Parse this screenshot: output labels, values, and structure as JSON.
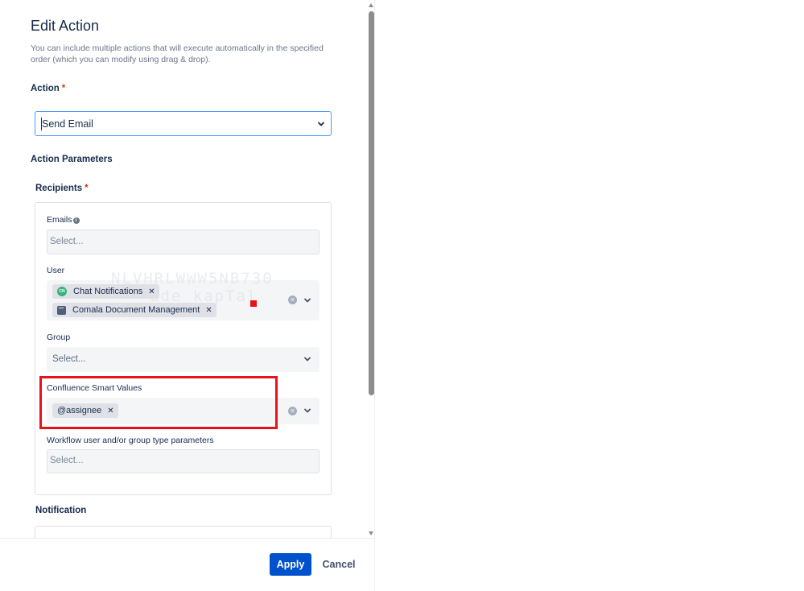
{
  "dialog": {
    "title": "Edit Action",
    "description": "You can include multiple actions that will execute automatically in the specified order (which you can modify using drag & drop)."
  },
  "action": {
    "label": "Action",
    "required_mark": "*",
    "selected_value": "Send Email"
  },
  "action_parameters": {
    "heading": "Action Parameters"
  },
  "recipients": {
    "label": "Recipients",
    "required_mark": "*",
    "emails": {
      "label": "Emails",
      "info_icon": "i",
      "placeholder": "Select..."
    },
    "user": {
      "label": "User",
      "chips": [
        {
          "label": "Chat Notifications",
          "icon": "CN"
        },
        {
          "label": "Comala Document Management",
          "icon": "document-icon"
        }
      ]
    },
    "group": {
      "label": "Group",
      "placeholder": "Select..."
    },
    "smart_values": {
      "label": "Confluence Smart Values",
      "chips": [
        {
          "label": "@assignee"
        }
      ]
    },
    "workflow_params": {
      "label": "Workflow user and/or group type parameters",
      "placeholder": "Select..."
    }
  },
  "notification": {
    "label": "Notification"
  },
  "watermark": {
    "line1": "NLVHRLWWW5NB730",
    "line2": "ude kapTal"
  },
  "footer": {
    "apply_label": "Apply",
    "cancel_label": "Cancel"
  },
  "colors": {
    "primary": "#0052cc",
    "focus": "#4c9aff",
    "highlight": "#e5141a",
    "required": "#de350b"
  }
}
